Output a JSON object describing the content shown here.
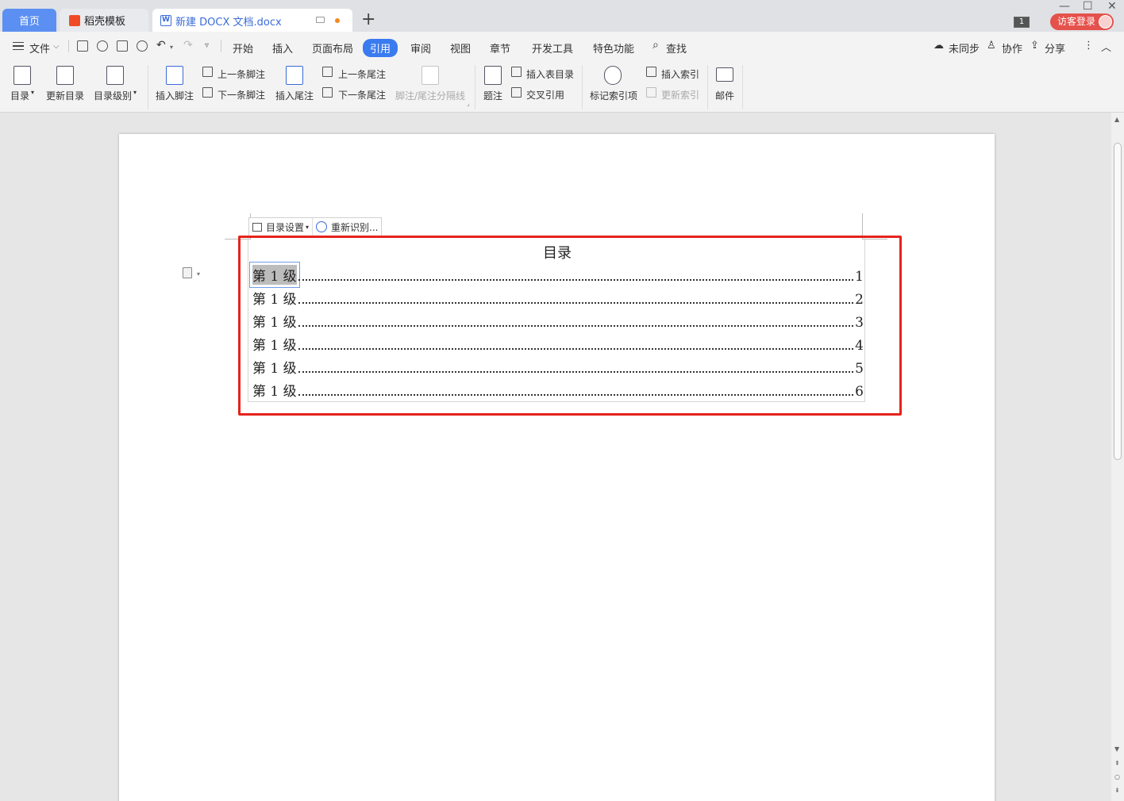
{
  "tabs": {
    "home": "首页",
    "templates": "稻壳模板",
    "document": "新建 DOCX 文档.docx",
    "new_tab": "+"
  },
  "window": {
    "minimize": "—",
    "maximize": "☐",
    "close": "✕",
    "page_badge": "1",
    "login": "访客登录"
  },
  "menu": {
    "file": "文件",
    "items": [
      "开始",
      "插入",
      "页面布局",
      "引用",
      "审阅",
      "视图",
      "章节",
      "开发工具",
      "特色功能"
    ],
    "active": "引用",
    "search": "查找",
    "sync": "未同步",
    "collab": "协作",
    "share": "分享"
  },
  "ribbon": {
    "toc": "目录",
    "update_toc": "更新目录",
    "toc_level": "目录级别",
    "insert_footnote": "插入脚注",
    "prev_footnote": "上一条脚注",
    "next_footnote": "下一条脚注",
    "insert_endnote": "插入尾注",
    "prev_endnote": "上一条尾注",
    "next_endnote": "下一条尾注",
    "separator_line": "脚注/尾注分隔线",
    "caption": "题注",
    "insert_table_of_figures": "插入表目录",
    "cross_reference": "交叉引用",
    "mark_index_entry": "标记索引项",
    "insert_index": "插入索引",
    "update_index": "更新索引",
    "mail": "邮件"
  },
  "toc_toolbar": {
    "settings": "目录设置",
    "recognize": "重新识别..."
  },
  "toc": {
    "title": "目录",
    "entries": [
      {
        "label": "第 1 级",
        "page": "1"
      },
      {
        "label": "第 1 级",
        "page": "2"
      },
      {
        "label": "第 1 级",
        "page": "3"
      },
      {
        "label": "第 1 级",
        "page": "4"
      },
      {
        "label": "第 1 级",
        "page": "5"
      },
      {
        "label": "第 1 级",
        "page": "6"
      }
    ]
  },
  "colors": {
    "accent": "#3b7bf0",
    "highlight_border": "#e5231c",
    "login_bg": "#e5514b"
  }
}
